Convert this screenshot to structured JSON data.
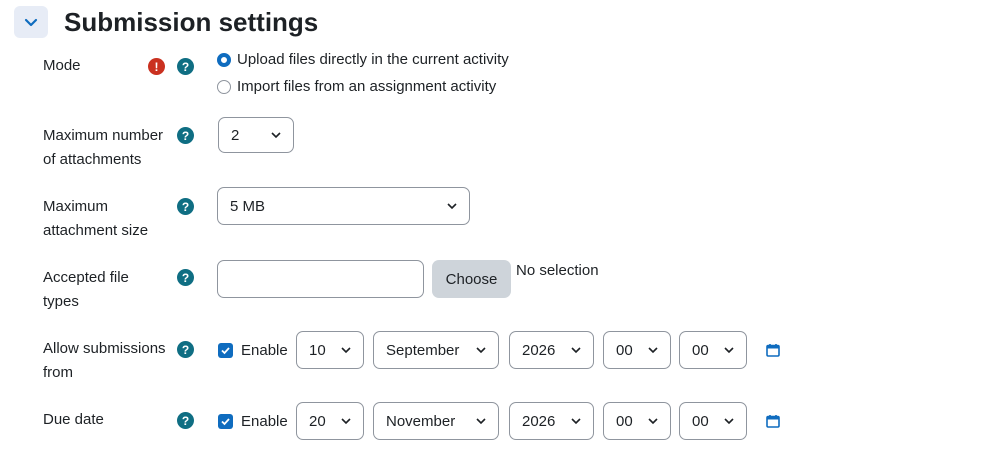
{
  "section": {
    "title": "Submission settings",
    "collapse_icon": "chevron-down-icon"
  },
  "mode": {
    "label": "Mode",
    "options": [
      {
        "label": "Upload files directly in the current activity",
        "selected": true
      },
      {
        "label": "Import files from an assignment activity",
        "selected": false
      }
    ]
  },
  "max_attachments": {
    "label_line1": "Maximum number",
    "label_line2": "of attachments",
    "value": "2"
  },
  "max_size": {
    "label_line1": "Maximum",
    "label_line2": "attachment size",
    "value": "5 MB"
  },
  "file_types": {
    "label_line1": "Accepted file",
    "label_line2": "types",
    "input_value": "",
    "choose_label": "Choose",
    "selection_text": "No selection"
  },
  "allow_from": {
    "label_line1": "Allow submissions",
    "label_line2": "from",
    "enable_label": "Enable",
    "enabled": true,
    "day": "10",
    "month": "September",
    "year": "2026",
    "hour": "00",
    "minute": "00"
  },
  "due_date": {
    "label": "Due date",
    "enable_label": "Enable",
    "enabled": true,
    "day": "20",
    "month": "November",
    "year": "2026",
    "hour": "00",
    "minute": "00"
  },
  "icons": {
    "help": "?",
    "required": "!"
  },
  "colors": {
    "accent": "#0f6cbf",
    "help": "#0f6e83",
    "required": "#ca3120",
    "button_bg": "#ced4da",
    "header_btn": "#e7ecf6"
  }
}
